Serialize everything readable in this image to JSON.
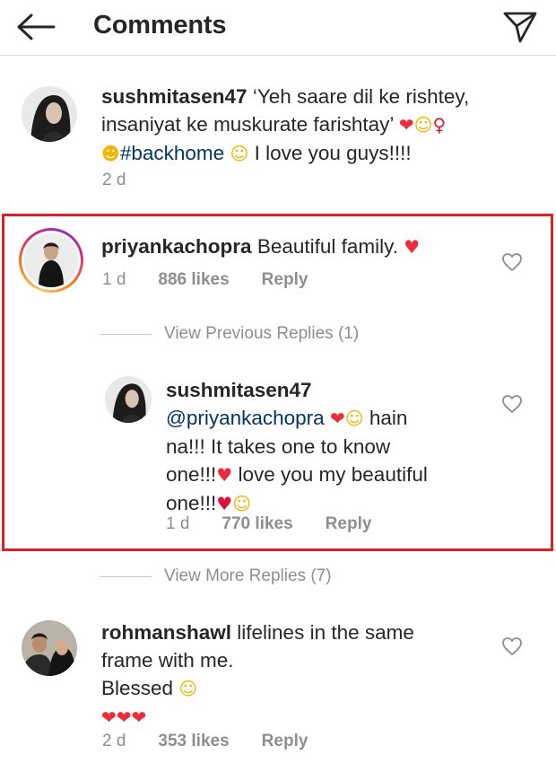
{
  "header": {
    "title": "Comments"
  },
  "caption": {
    "username": "sushmitasen47",
    "text_line1": " ‘Yeh saare dil ke rishtey,",
    "text_line2": "insaniyat ke muskurate farishtay’ ",
    "hashtag": "#backhome",
    "text_line3_tail": " I love you guys!!!!",
    "time": "2 d"
  },
  "comments": [
    {
      "username": "priyankachopra",
      "text": " Beautiful family. ",
      "time": "1 d",
      "likes": "886 likes",
      "reply_label": "Reply",
      "view_previous_label": "View Previous Replies (1)",
      "replies": [
        {
          "username": "sushmitasen47",
          "mention": "@priyankachopra",
          "text_line1_tail": " hain",
          "text_line2": "na!!! It takes one to know",
          "text_line3": "one!!!",
          "text_line3_tail": " love you my beautiful",
          "text_line4": "one!!!",
          "time": "1 d",
          "likes": "770 likes",
          "reply_label": "Reply"
        }
      ],
      "view_more_label": "View More Replies (7)"
    },
    {
      "username": "rohmanshawl",
      "text_line1": " lifelines in the same",
      "text_line2": "frame with me.",
      "text_line3": "Blessed ",
      "time": "2 d",
      "likes": "353 likes",
      "reply_label": "Reply"
    }
  ],
  "colors": {
    "highlight_border": "#dd1f2a",
    "link": "#003569",
    "muted": "#8e8e8e",
    "heart": "#ed2b3b"
  },
  "icons": {
    "back": "arrow-left-icon",
    "share": "paper-plane-icon",
    "like": "heart-outline-icon"
  }
}
